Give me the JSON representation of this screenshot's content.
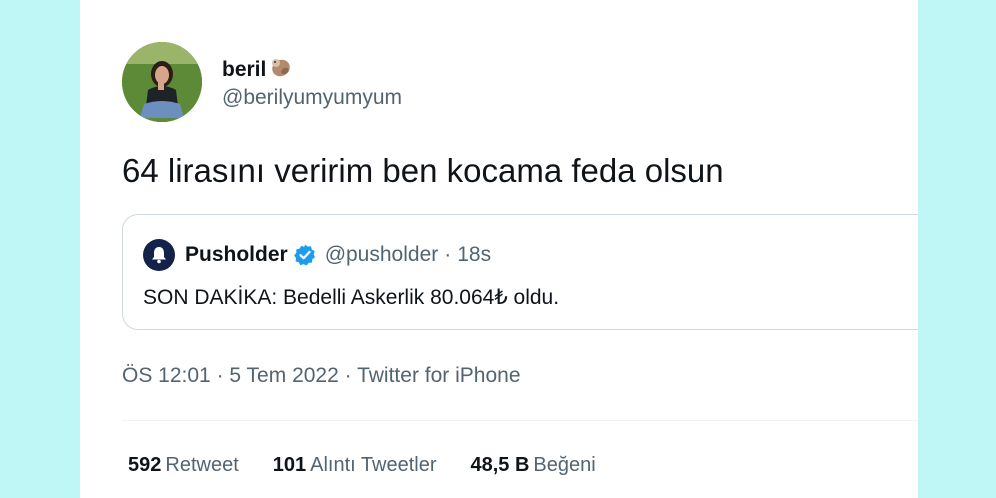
{
  "colors": {
    "background": "#bff6f6",
    "card": "#ffffff",
    "text_primary": "#0f1419",
    "text_secondary": "#536471",
    "verified_blue": "#1d9bf0",
    "pusholder_logo_bg": "#14224a"
  },
  "author": {
    "display_name": "beril",
    "name_emoji_icon": "otter-emoji-icon",
    "username": "@berilyumyumyum"
  },
  "tweet": {
    "text": "64 lirasını veririm ben kocama feda olsun"
  },
  "quoted_tweet": {
    "logo_icon": "bell-icon",
    "name": "Pusholder",
    "verified_icon": "verified-badge-icon",
    "handle": "@pusholder",
    "separator": "·",
    "time": "18s",
    "text": "SON DAKİKA: Bedelli Askerlik 80.064₺ oldu."
  },
  "meta": {
    "time": "ÖS 12:01",
    "separator_1": "·",
    "date": "5 Tem 2022",
    "separator_2": "·",
    "source": "Twitter for iPhone"
  },
  "stats": {
    "retweets_count": "592",
    "retweets_label": "Retweet",
    "quotes_count": "101",
    "quotes_label": "Alıntı Tweetler",
    "likes_count": "48,5 B",
    "likes_label": "Beğeni"
  }
}
